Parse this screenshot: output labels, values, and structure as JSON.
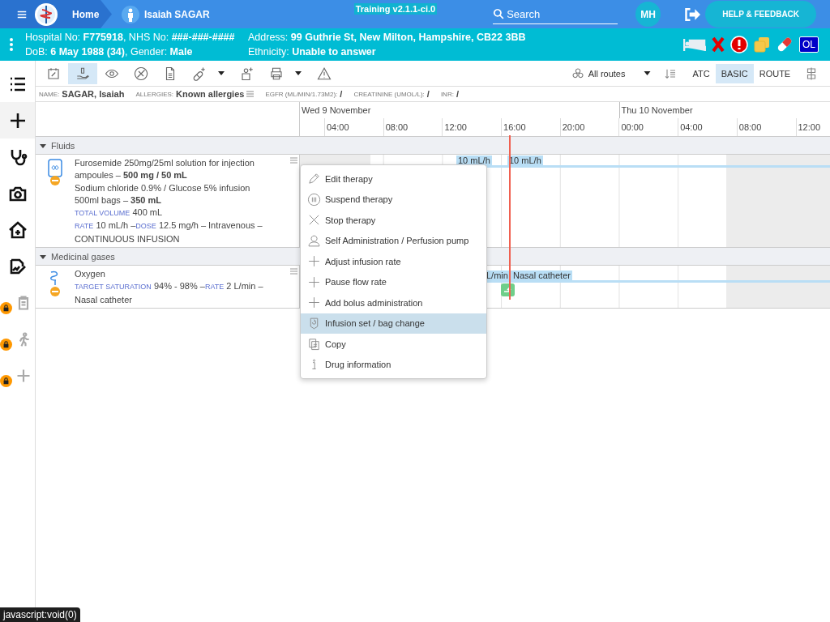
{
  "top_bar": {
    "home": "Home",
    "patient_name": "Isaiah SAGAR",
    "environment_badge": "Training v2.1.1-ci.0",
    "search": {
      "placeholder": "Search"
    },
    "user_initials": "MH",
    "help_button": "HELP & FEEDBACK"
  },
  "patient_banner": {
    "lines": [
      "Hospital No: **F775918**, NHS No: **###-###-####**",
      "Address: **99 Guthrie St, New Milton, Hampshire, CB22 3BB**",
      "DoB: **6 May 1988 (34)**, Gender: **Male**",
      "Ethnicity: **Unable to answer**"
    ],
    "badge": "OL"
  },
  "sidebar": {
    "items": [
      {
        "kind": "list",
        "selected": false,
        "locked": false
      },
      {
        "kind": "plus",
        "selected": true,
        "locked": false
      },
      {
        "kind": "stethoscope",
        "selected": false,
        "locked": false
      },
      {
        "kind": "camera",
        "selected": false,
        "locked": false
      },
      {
        "kind": "house",
        "selected": false,
        "locked": false
      },
      {
        "kind": "signature",
        "selected": false,
        "locked": false
      },
      {
        "kind": "clipboard",
        "selected": false,
        "locked": true
      },
      {
        "kind": "walker",
        "selected": false,
        "locked": true
      },
      {
        "kind": "plus",
        "selected": false,
        "locked": true
      }
    ]
  },
  "toolbar": {
    "tools": [
      {
        "kind": "calendar-pill",
        "selected": false,
        "dropdown": false
      },
      {
        "kind": "hand-pill",
        "selected": true,
        "dropdown": false
      },
      {
        "kind": "eye",
        "selected": false,
        "dropdown": false
      },
      {
        "kind": "pill-off",
        "selected": false,
        "dropdown": false
      },
      {
        "kind": "document",
        "selected": false,
        "dropdown": false
      },
      {
        "kind": "pill-add",
        "selected": false,
        "dropdown": true
      },
      {
        "kind": "person-add",
        "selected": false,
        "dropdown": false
      },
      {
        "kind": "print",
        "selected": false,
        "dropdown": true
      },
      {
        "kind": "warning",
        "selected": false,
        "dropdown": false
      }
    ],
    "routes_filter": "All routes",
    "view_modes": [
      {
        "label": "ATC",
        "selected": false
      },
      {
        "label": "BASIC",
        "selected": true
      },
      {
        "label": "ROUTE",
        "selected": false
      }
    ]
  },
  "info_bar": [
    {
      "label": "NAME:",
      "value": "SAGAR, Isaiah",
      "has_menu": false
    },
    {
      "label": "ALLERGIES:",
      "value": "Known allergies",
      "has_menu": true
    },
    {
      "label": "EGFR (ML/MIN/1.73M2):",
      "value": "/",
      "has_menu": false
    },
    {
      "label": "CREATININE (UMOL/L):",
      "value": "/",
      "has_menu": false
    },
    {
      "label": "INR:",
      "value": "/",
      "has_menu": false
    }
  ],
  "timeline": {
    "days": [
      "Wed 9 November",
      "Thu 10 November"
    ],
    "hours": [
      "04:00",
      "08:00",
      "12:00",
      "16:00",
      "20:00",
      "00:00",
      "04:00",
      "08:00",
      "12:00"
    ]
  },
  "groups": [
    {
      "name": "Fluids",
      "expanded": true,
      "therapies": [
        {
          "kind": "infusion",
          "lines": [
            {
              "kind": "text",
              "text": "Furosemide 250mg/25ml solution for injection ampoules – **500 mg / 50 mL**"
            },
            {
              "kind": "text",
              "text": "Sodium chloride 0.9% / Glucose 5% infusion 500ml bags – **350 mL**"
            },
            {
              "kind": "fields",
              "parts": [
                {
                  "label": "TOTAL VOLUME",
                  "value": "400 mL"
                }
              ]
            },
            {
              "kind": "fields",
              "parts": [
                {
                  "label": "RATE",
                  "value": "10 mL/h –"
                },
                {
                  "label": "DOSE",
                  "value": "12.5 mg/h – Intravenous – CONTINUOUS INFUSION"
                }
              ]
            }
          ],
          "bar_labels": [
            "10 mL/h",
            "10 mL/h"
          ],
          "administered": false
        }
      ]
    },
    {
      "name": "Medicinal gases",
      "expanded": true,
      "therapies": [
        {
          "kind": "oxygen",
          "lines": [
            {
              "kind": "text",
              "text": "Oxygen"
            },
            {
              "kind": "fields",
              "parts": [
                {
                  "label": "TARGET SATURATION",
                  "value": "94% - 98% –"
                },
                {
                  "label": "RATE",
                  "value": "2 L/min – Nasal catheter"
                }
              ]
            }
          ],
          "bar_labels": [
            "L/min, Nasal catheter"
          ],
          "administered": true
        }
      ]
    }
  ],
  "context_menu": [
    {
      "kind": "pencil",
      "label": "Edit therapy",
      "selected": false
    },
    {
      "kind": "pause",
      "label": "Suspend therapy",
      "selected": false
    },
    {
      "kind": "close",
      "label": "Stop therapy",
      "selected": false
    },
    {
      "kind": "person",
      "label": "Self Administration / Perfusion pump",
      "selected": false
    },
    {
      "kind": "plus",
      "label": "Adjust infusion rate",
      "selected": false
    },
    {
      "kind": "plus",
      "label": "Pause flow rate",
      "selected": false
    },
    {
      "kind": "plus",
      "label": "Add bolus administration",
      "selected": false
    },
    {
      "kind": "bag-change",
      "label": "Infusion set / bag change",
      "selected": true
    },
    {
      "kind": "copy",
      "label": "Copy",
      "selected": false
    },
    {
      "kind": "info",
      "label": "Drug information",
      "selected": false
    }
  ],
  "status_tooltip": "javascript:void(0)"
}
